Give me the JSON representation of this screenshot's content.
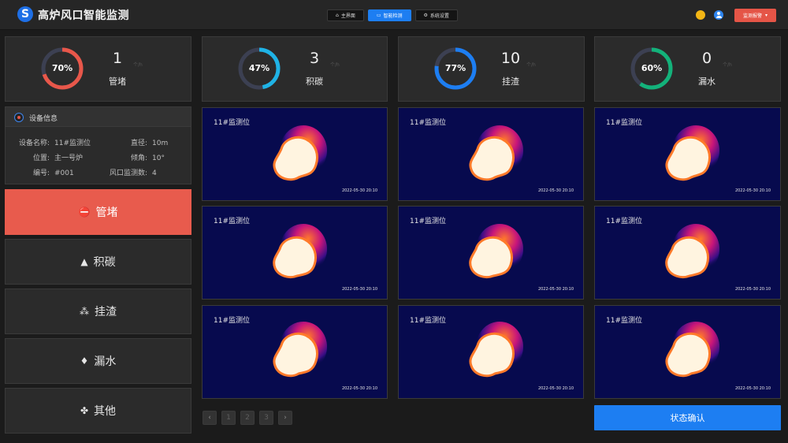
{
  "header": {
    "logo_letter": "S",
    "title": "高炉风口智能监测",
    "nav": [
      {
        "label": "主界面",
        "icon": "home-icon",
        "active": false
      },
      {
        "label": "智能检测",
        "icon": "monitor-icon",
        "active": true
      },
      {
        "label": "系统设置",
        "icon": "gear-icon",
        "active": false
      }
    ],
    "alarm_button": "监测报警"
  },
  "stats": [
    {
      "percent_text": "70%",
      "percent": 70,
      "count": "1",
      "unit": "个/h",
      "label": "管堵",
      "color": "#e8574a"
    },
    {
      "percent_text": "47%",
      "percent": 47,
      "count": "3",
      "unit": "个/h",
      "label": "积碳",
      "color": "#1fb3e6"
    },
    {
      "percent_text": "77%",
      "percent": 77,
      "count": "10",
      "unit": "个/h",
      "label": "挂渣",
      "color": "#1d7ef2"
    },
    {
      "percent_text": "60%",
      "percent": 60,
      "count": "0",
      "unit": "个/h",
      "label": "漏水",
      "color": "#13b27a"
    }
  ],
  "device_info": {
    "title": "设备信息",
    "name_key": "设备名称:",
    "name_val": "11#监测位",
    "diameter_key": "直径:",
    "diameter_val": "10m",
    "position_key": "位置:",
    "position_val": "主一号炉",
    "angle_key": "倾角:",
    "angle_val": "10°",
    "code_key": "编号:",
    "code_val": "#001",
    "tuyere_key": "风口监测数:",
    "tuyere_val": "4"
  },
  "categories": [
    {
      "label": "管堵",
      "icon": "block-icon",
      "active": true
    },
    {
      "label": "积碳",
      "icon": "mountain-icon",
      "active": false
    },
    {
      "label": "挂渣",
      "icon": "slag-icon",
      "active": false
    },
    {
      "label": "漏水",
      "icon": "water-drop-icon",
      "active": false
    },
    {
      "label": "其他",
      "icon": "grid-icon",
      "active": false
    }
  ],
  "cards": [
    {
      "location": "11#监测位",
      "timestamp": "2022-05-30 20:10"
    },
    {
      "location": "11#监测位",
      "timestamp": "2022-05-30 20:10"
    },
    {
      "location": "11#监测位",
      "timestamp": "2022-05-30 20:10"
    },
    {
      "location": "11#监测位",
      "timestamp": "2022-05-30 20:10"
    },
    {
      "location": "11#监测位",
      "timestamp": "2022-05-30 20:10"
    },
    {
      "location": "11#监测位",
      "timestamp": "2022-05-30 20:10"
    },
    {
      "location": "11#监测位",
      "timestamp": "2022-05-30 20:10"
    },
    {
      "location": "11#监测位",
      "timestamp": "2022-05-30 20:10"
    },
    {
      "location": "11#监测位",
      "timestamp": "2022-05-30 20:10"
    }
  ],
  "pagination": {
    "prev": "‹",
    "pages": [
      "1",
      "2",
      "3"
    ],
    "next": "›"
  },
  "confirm_button": "状态确认"
}
